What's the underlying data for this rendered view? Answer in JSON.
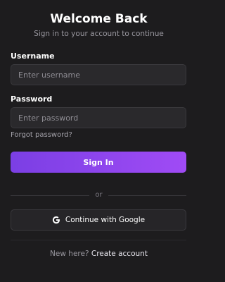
{
  "header": {
    "title": "Welcome Back",
    "subtitle": "Sign in to your account to continue"
  },
  "form": {
    "username_label": "Username",
    "username_placeholder": "Enter username",
    "username_value": "",
    "password_label": "Password",
    "password_placeholder": "Enter password",
    "password_value": "",
    "forgot_label": "Forgot password?",
    "signin_label": "Sign In"
  },
  "divider": {
    "text": "or"
  },
  "social": {
    "google_label": "Continue with Google",
    "icon": "google-g-icon"
  },
  "footer": {
    "question": "New here?",
    "link": "Create account"
  },
  "colors": {
    "background": "#1d1c1e",
    "accent_start": "#7b3fe4",
    "accent_end": "#a04bf5"
  }
}
